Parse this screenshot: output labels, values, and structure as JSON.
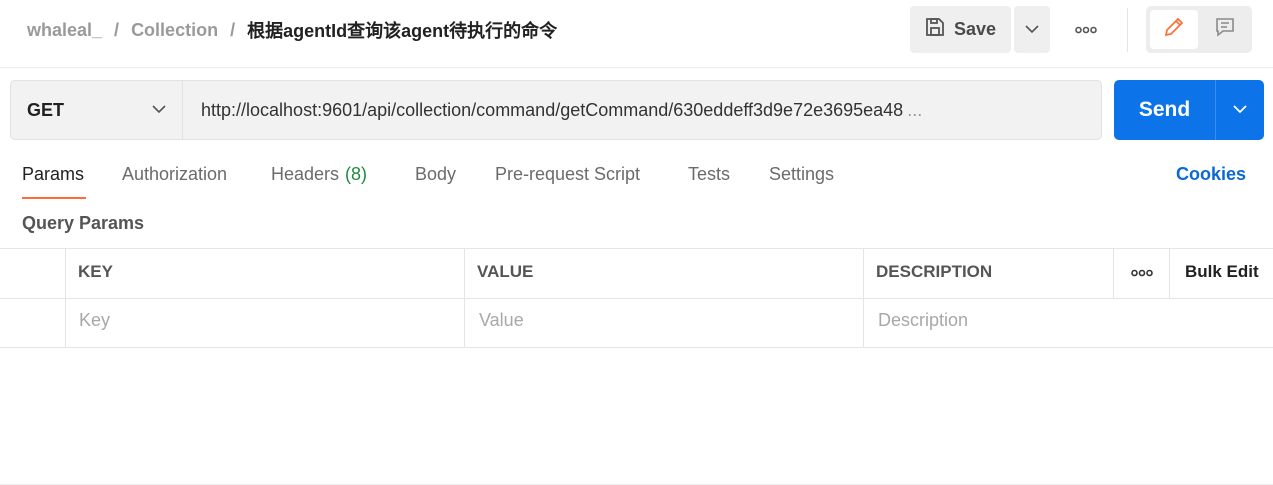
{
  "breadcrumb": {
    "workspace": "whaleal_",
    "separator": "/",
    "collection": "Collection",
    "request_name": "根据agentId查询该agent待执行的命令"
  },
  "toolbar": {
    "save_label": "Save",
    "save_icon": "save-disk-icon",
    "more_icon": "more-dots-icon",
    "edit_icon": "pencil-icon",
    "comments_icon": "comment-icon"
  },
  "request": {
    "method": "GET",
    "url": "http://localhost:9601/api/collection/command/getCommand/630eddeff3d9e72e3695ea48",
    "url_ellipsis": "...",
    "send_label": "Send"
  },
  "tabs": [
    {
      "label": "Params",
      "active": true
    },
    {
      "label": "Authorization"
    },
    {
      "label": "Headers",
      "count": "(8)"
    },
    {
      "label": "Body"
    },
    {
      "label": "Pre-request Script"
    },
    {
      "label": "Tests"
    },
    {
      "label": "Settings"
    }
  ],
  "cookies_label": "Cookies",
  "query_params": {
    "title": "Query Params",
    "columns": [
      "KEY",
      "VALUE",
      "DESCRIPTION"
    ],
    "bulk_edit_label": "Bulk Edit",
    "placeholders": {
      "key": "Key",
      "value": "Value",
      "description": "Description"
    }
  },
  "colors": {
    "accent": "#ff6c37",
    "send": "#0c74e8",
    "link": "#0c69d3",
    "count": "#1f8b3e"
  }
}
